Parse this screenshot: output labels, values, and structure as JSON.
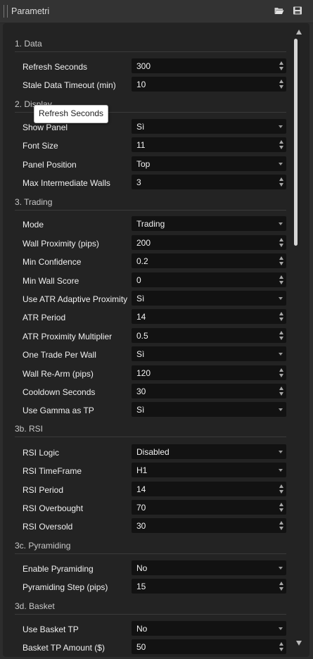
{
  "window": {
    "title": "Parametri",
    "open_icon": "folder-open-icon",
    "save_icon": "save-icon"
  },
  "tooltip": "Refresh Seconds",
  "sections": {
    "data": "1. Data",
    "display": "2. Display",
    "trading": "3. Trading",
    "rsi": "3b. RSI",
    "pyramiding": "3c. Pyramiding",
    "basket": "3d. Basket"
  },
  "params": {
    "refresh_seconds": {
      "label": "Refresh Seconds",
      "value": "300"
    },
    "stale_data_timeout": {
      "label": "Stale Data Timeout (min)",
      "value": "10"
    },
    "show_panel": {
      "label": "Show Panel",
      "value": "Sì"
    },
    "font_size": {
      "label": "Font Size",
      "value": "11"
    },
    "panel_position": {
      "label": "Panel Position",
      "value": "Top"
    },
    "max_intermediate_walls": {
      "label": "Max Intermediate Walls",
      "value": "3"
    },
    "mode": {
      "label": "Mode",
      "value": "Trading"
    },
    "wall_proximity": {
      "label": "Wall Proximity (pips)",
      "value": "200"
    },
    "min_confidence": {
      "label": "Min Confidence",
      "value": "0.2"
    },
    "min_wall_score": {
      "label": "Min Wall Score",
      "value": "0"
    },
    "use_atr_adaptive": {
      "label": "Use ATR Adaptive Proximity",
      "value": "Sì"
    },
    "atr_period": {
      "label": "ATR Period",
      "value": "14"
    },
    "atr_proximity_multiplier": {
      "label": "ATR Proximity Multiplier",
      "value": "0.5"
    },
    "one_trade_per_wall": {
      "label": "One Trade Per Wall",
      "value": "Sì"
    },
    "wall_rearm": {
      "label": "Wall Re-Arm (pips)",
      "value": "120"
    },
    "cooldown_seconds": {
      "label": "Cooldown Seconds",
      "value": "30"
    },
    "use_gamma_as_tp": {
      "label": "Use Gamma as TP",
      "value": "Sì"
    },
    "rsi_logic": {
      "label": "RSI Logic",
      "value": "Disabled"
    },
    "rsi_timeframe": {
      "label": "RSI TimeFrame",
      "value": "H1"
    },
    "rsi_period": {
      "label": "RSI Period",
      "value": "14"
    },
    "rsi_overbought": {
      "label": "RSI Overbought",
      "value": "70"
    },
    "rsi_oversold": {
      "label": "RSI Oversold",
      "value": "30"
    },
    "enable_pyramiding": {
      "label": "Enable Pyramiding",
      "value": "No"
    },
    "pyramiding_step": {
      "label": "Pyramiding Step (pips)",
      "value": "15"
    },
    "use_basket_tp": {
      "label": "Use Basket TP",
      "value": "No"
    },
    "basket_tp_amount": {
      "label": "Basket TP Amount ($)",
      "value": "50"
    }
  },
  "scrollbar": {
    "position": 0.0
  }
}
